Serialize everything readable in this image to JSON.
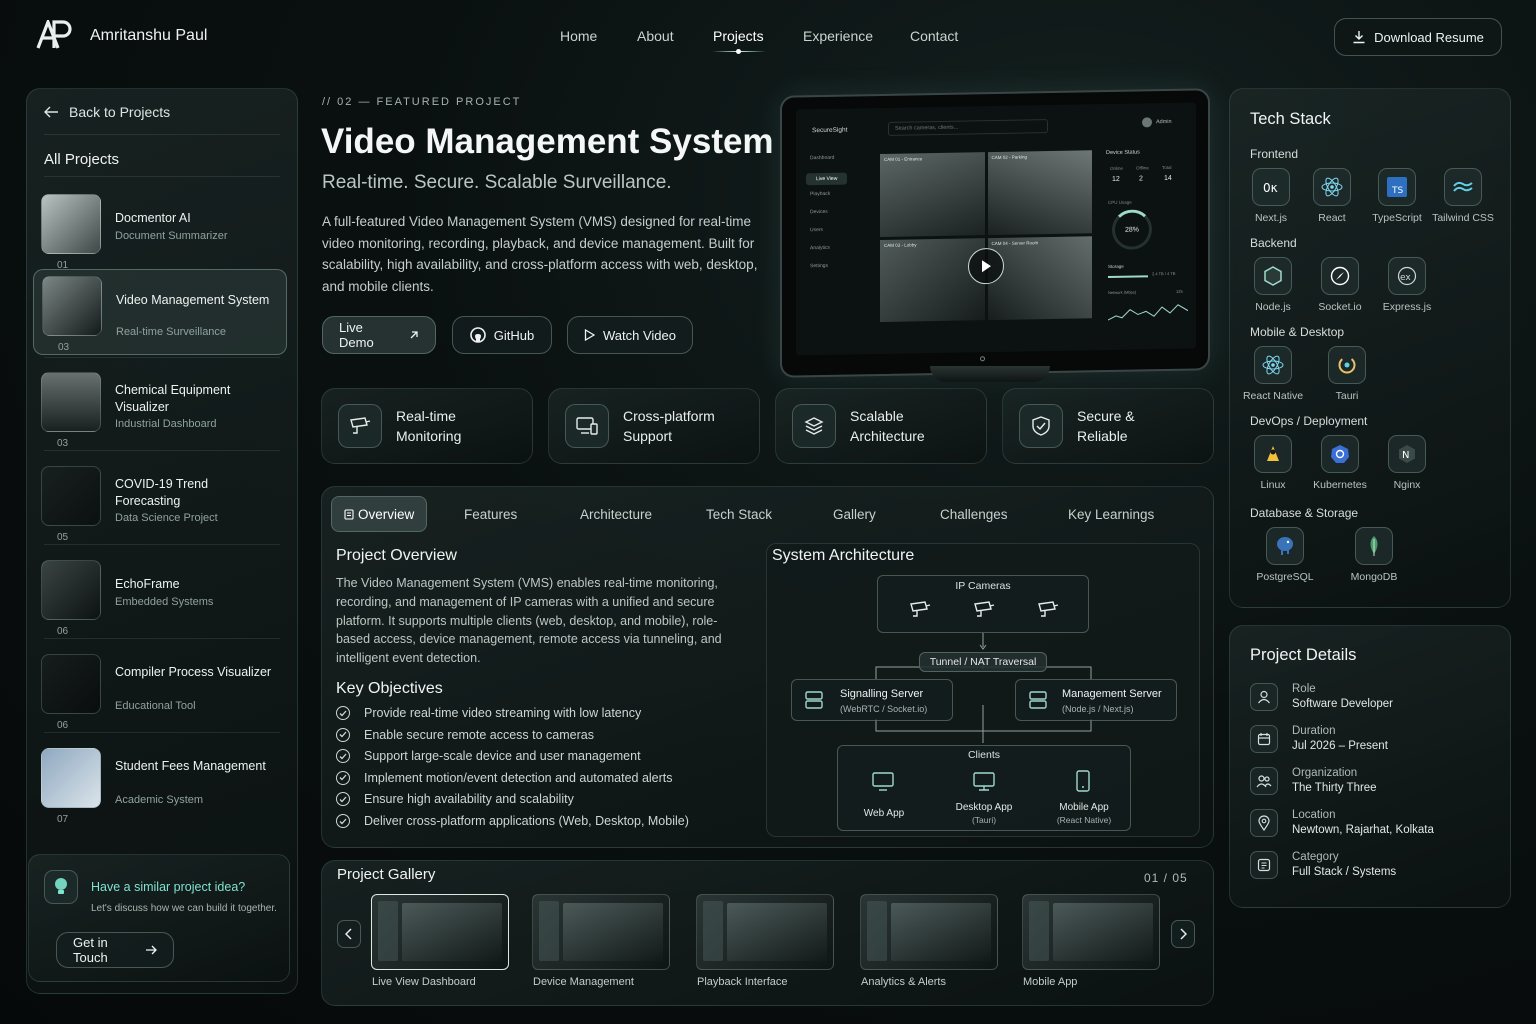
{
  "header": {
    "brand": "Amritanshu Paul",
    "nav": [
      "Home",
      "About",
      "Projects",
      "Experience",
      "Contact"
    ],
    "active_nav": "Projects",
    "download_label": "Download Resume"
  },
  "sidebar": {
    "back_label": "Back to Projects",
    "title": "All Projects",
    "projects": [
      {
        "title": "Docmentor AI",
        "subtitle": "Document Summarizer",
        "num": "01"
      },
      {
        "title": "Video Management System",
        "subtitle": "Real-time Surveillance",
        "num": "03"
      },
      {
        "title": "Chemical Equipment Visualizer",
        "subtitle": "Industrial Dashboard",
        "num": "03"
      },
      {
        "title": "COVID-19 Trend Forecasting",
        "subtitle": "Data Science Project",
        "num": "05"
      },
      {
        "title": "EchoFrame",
        "subtitle": "Embedded Systems",
        "num": "06"
      },
      {
        "title": "Compiler Process Visualizer",
        "subtitle": "Educational Tool",
        "num": "06"
      },
      {
        "title": "Student Fees Management",
        "subtitle": "Academic System",
        "num": "07"
      }
    ],
    "cta": {
      "title": "Have a similar project idea?",
      "subtitle": "Let's discuss how we can build it together.",
      "button": "Get in Touch"
    }
  },
  "hero": {
    "eyebrow": "// 02 — FEATURED PROJECT",
    "title": "Video Management System",
    "tagline": "Real-time. Secure. Scalable Surveillance.",
    "description": "A full-featured Video Management System (VMS) designed for real-time video monitoring, recording, playback, and device management. Built for scalability, high availability, and cross-platform access with web, desktop, and mobile clients.",
    "buttons": {
      "live_demo": "Live Demo",
      "github": "GitHub",
      "watch_video": "Watch Video"
    }
  },
  "mockup": {
    "app_name": "SecureSight",
    "search_placeholder": "Search cameras, clients...",
    "user": "Admin",
    "menu": [
      "Dashboard",
      "Live View",
      "Playback",
      "Devices",
      "Users",
      "Analytics",
      "Settings"
    ],
    "cams": [
      "CAM 01 - Entrance",
      "CAM 02 - Parking",
      "CAM 03 - Lobby",
      "CAM 04 - Server Room"
    ],
    "device_status_title": "Device Status",
    "status_labels": [
      "Online",
      "Offline",
      "Total"
    ],
    "status_values": [
      "12",
      "2",
      "14"
    ],
    "cpu_label": "CPU Usage",
    "cpu_value": "28%",
    "storage_label": "Storage",
    "storage_value": "2.4 TB / 4 TB",
    "network_label": "Network (Mbps)",
    "network_value": "125"
  },
  "features": [
    "Real-time Monitoring",
    "Cross-platform Support",
    "Scalable Architecture",
    "Secure & Reliable"
  ],
  "tabs": [
    "Overview",
    "Features",
    "Architecture",
    "Tech Stack",
    "Gallery",
    "Challenges",
    "Key Learnings"
  ],
  "active_tab": "Overview",
  "overview": {
    "title": "Project Overview",
    "text": "The Video Management System (VMS) enables real-time monitoring, recording, and management of IP cameras with a unified and secure platform. It supports multiple clients (web, desktop, and mobile), role-based access, device management, remote access via tunneling, and intelligent event detection.",
    "objectives_title": "Key Objectives",
    "objectives": [
      "Provide real-time video streaming with low latency",
      "Enable secure remote access to cameras",
      "Support large-scale device and user management",
      "Implement motion/event detection and automated alerts",
      "Ensure high availability and scalability",
      "Deliver cross-platform applications (Web, Desktop, Mobile)"
    ]
  },
  "architecture": {
    "title": "System Architecture",
    "cameras": "IP Cameras",
    "tunnel": "Tunnel / NAT Traversal",
    "signalling": {
      "name": "Signalling Server",
      "detail": "(WebRTC / Socket.io)"
    },
    "management": {
      "name": "Management Server",
      "detail": "(Node.js / Next.js)"
    },
    "clients_title": "Clients",
    "clients": [
      {
        "name": "Web App",
        "detail": ""
      },
      {
        "name": "Desktop App",
        "detail": "(Tauri)"
      },
      {
        "name": "Mobile App",
        "detail": "(React Native)"
      }
    ]
  },
  "gallery": {
    "title": "Project Gallery",
    "counter": "01 / 05",
    "items": [
      "Live View Dashboard",
      "Device Management",
      "Playback Interface",
      "Analytics & Alerts",
      "Mobile App"
    ]
  },
  "tech_stack": {
    "title": "Tech Stack",
    "sections": [
      {
        "name": "Frontend",
        "items": [
          "Next.js",
          "React",
          "TypeScript",
          "Tailwind CSS"
        ]
      },
      {
        "name": "Backend",
        "items": [
          "Node.js",
          "Socket.io",
          "Express.js"
        ]
      },
      {
        "name": "Mobile & Desktop",
        "items": [
          "React Native",
          "Tauri"
        ]
      },
      {
        "name": "DevOps / Deployment",
        "items": [
          "Linux",
          "Kubernetes",
          "Nginx"
        ]
      },
      {
        "name": "Database & Storage",
        "items": [
          "PostgreSQL",
          "MongoDB"
        ]
      }
    ]
  },
  "details": {
    "title": "Project Details",
    "rows": [
      {
        "key": "Role",
        "value": "Software Developer"
      },
      {
        "key": "Duration",
        "value": "Jul 2026 – Present"
      },
      {
        "key": "Organization",
        "value": "The Thirty Three"
      },
      {
        "key": "Location",
        "value": "Newtown, Rajarhat, Kolkata"
      },
      {
        "key": "Category",
        "value": "Full Stack / Systems"
      }
    ]
  },
  "colors": {
    "accent": "#7fd1c0",
    "bg": "#0a1010",
    "panel": "#141e1e"
  }
}
